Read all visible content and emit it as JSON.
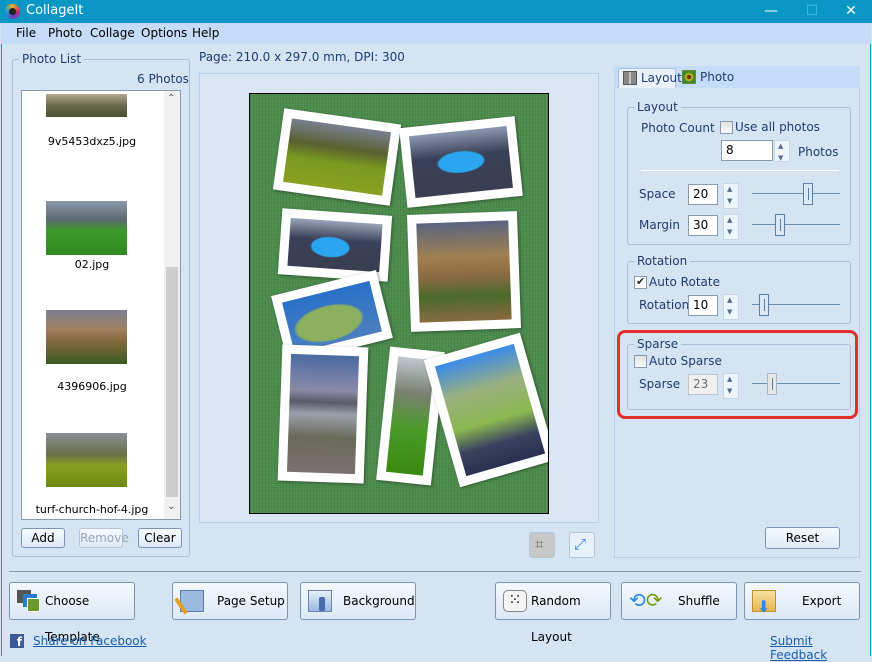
{
  "window": {
    "title": "CollageIt",
    "minimize": "—",
    "maximize": "☐",
    "close": "✕"
  },
  "menu": [
    "File",
    "Photo",
    "Collage",
    "Options",
    "Help"
  ],
  "photo_list": {
    "legend": "Photo List",
    "count": "6 Photos",
    "items": [
      {
        "name": "9v5453dxz5.jpg",
        "colors": [
          "#8a9070",
          "#5a6040"
        ]
      },
      {
        "name": "02.jpg",
        "colors": [
          "#7a8c9a",
          "#3a9a2a"
        ]
      },
      {
        "name": "4396906.jpg",
        "colors": [
          "#7a7a8a",
          "#a07a40"
        ]
      },
      {
        "name": "turf-church-hof-4.jpg",
        "colors": [
          "#8a8a90",
          "#8a9a20"
        ]
      }
    ],
    "buttons": {
      "add": "Add",
      "remove": "Remove",
      "clear": "Clear"
    }
  },
  "page_info": "Page: 210.0 x 297.0 mm, DPI: 300",
  "tabs": [
    {
      "label": "Layout",
      "active": true
    },
    {
      "label": "Photo",
      "active": false
    }
  ],
  "layout": {
    "legend": "Layout",
    "photo_count_label": "Photo Count",
    "use_all_label": "Use all photos",
    "use_all_checked": false,
    "photo_count": "8",
    "photos_unit": "Photos",
    "space_label": "Space",
    "space": "20",
    "space_slider_pct": 64,
    "margin_label": "Margin",
    "margin": "30",
    "margin_slider_pct": 32
  },
  "rotation": {
    "legend": "Rotation",
    "auto_label": "Auto Rotate",
    "auto_checked": true,
    "rotation_label": "Rotation",
    "rotation": "10",
    "slider_pct": 14
  },
  "sparse": {
    "legend": "Sparse",
    "auto_label": "Auto Sparse",
    "auto_checked": false,
    "sparse_label": "Sparse",
    "sparse": "23",
    "slider_pct": 23
  },
  "reset_label": "Reset",
  "bottom_buttons": {
    "choose_template": "Choose Template",
    "page_setup": "Page Setup",
    "background": "Background",
    "random_layout": "Random Layout",
    "shuffle": "Shuffle",
    "export": "Export"
  },
  "links": {
    "facebook": "Share on Facebook",
    "feedback": "Submit Feedback"
  }
}
